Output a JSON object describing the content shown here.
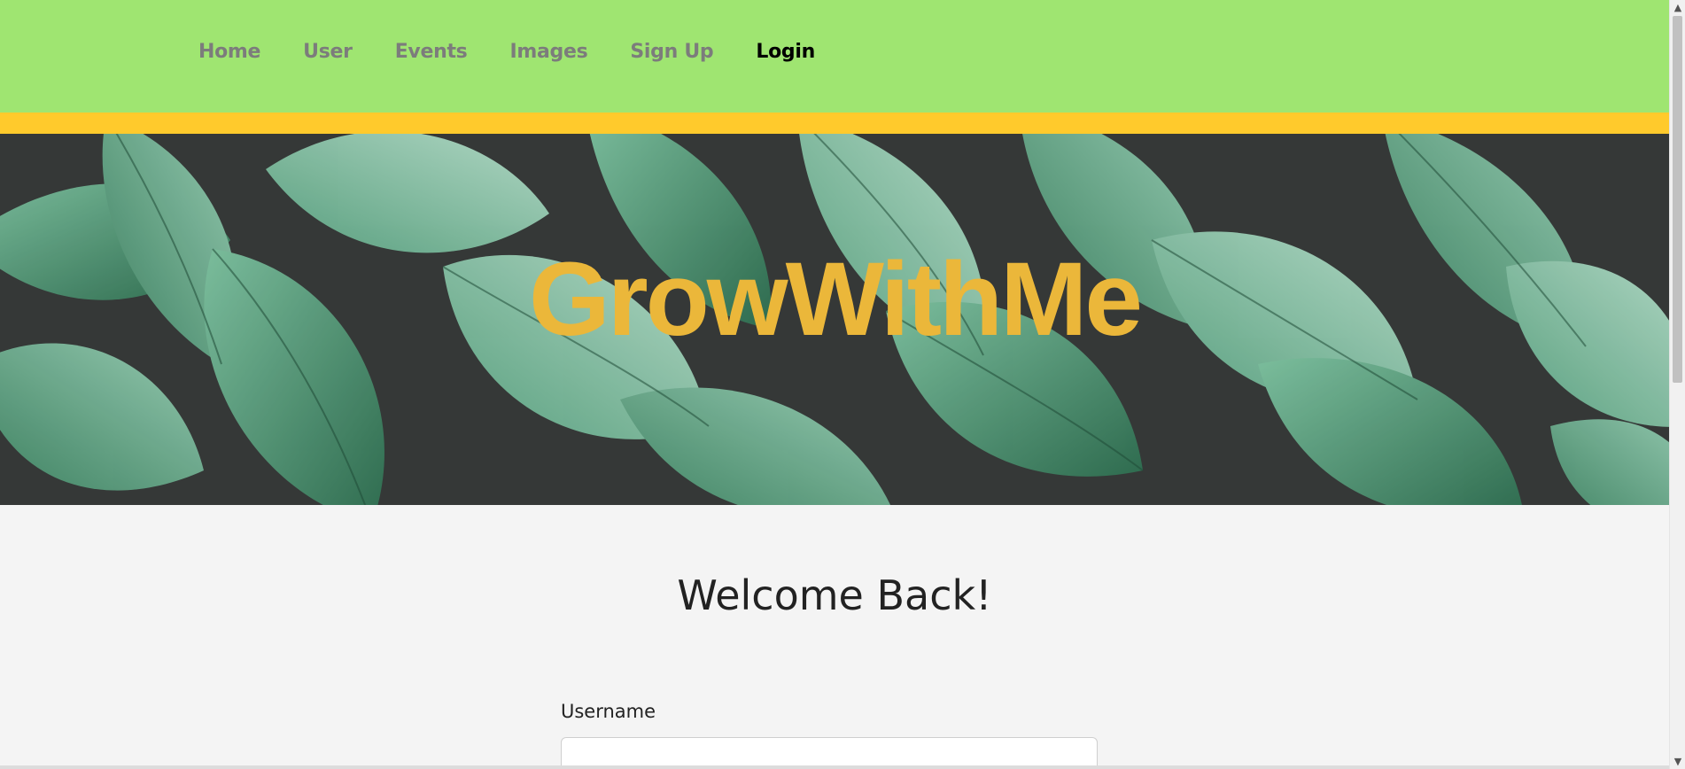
{
  "nav": {
    "items": [
      {
        "label": "Home"
      },
      {
        "label": "User"
      },
      {
        "label": "Events"
      },
      {
        "label": "Images"
      },
      {
        "label": "Sign Up"
      },
      {
        "label": "Login",
        "active": true
      }
    ]
  },
  "hero": {
    "title": "GrowWithMe"
  },
  "main": {
    "heading": "Welcome Back!",
    "username_label": "Username",
    "username_value": ""
  },
  "colors": {
    "nav_bg": "#9fe571",
    "accent_bar": "#ffca2c",
    "title": "#ebb73a",
    "page_bg": "#f4f4f4"
  }
}
